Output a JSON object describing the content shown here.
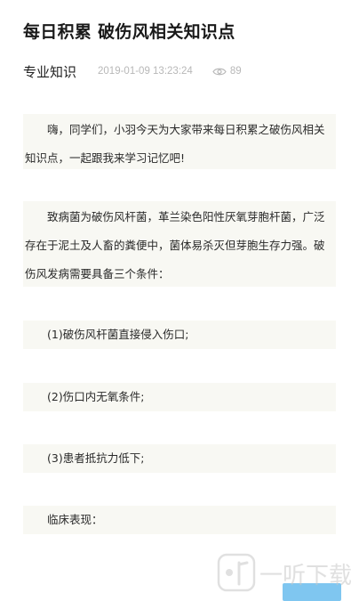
{
  "article": {
    "title": "每日积累 破伤风相关知识点",
    "category": "专业知识",
    "timestamp": "2019-01-09 13:23:24",
    "view_count": "89"
  },
  "content": {
    "intro": "嗨，同学们，小羽今天为大家带来每日积累之破伤风相关知识点，一起跟我来学习记忆吧!",
    "pathogen": "致病菌为破伤风杆菌，革兰染色阳性厌氧芽胞杆菌，广泛存在于泥土及人畜的粪便中，菌体易杀灭但芽胞生存力强。破伤风发病需要具备三个条件：",
    "condition_1": "(1)破伤风杆菌直接侵入伤口;",
    "condition_2": "(2)伤口内无氧条件;",
    "condition_3": "(3)患者抵抗力低下;",
    "clinical_heading": "临床表现："
  },
  "watermark": {
    "text": "一听下载"
  },
  "colors": {
    "block_bg": "#f8f8f3",
    "meta_gray": "#b8b8b8",
    "button_blue": "#7fc6f0"
  }
}
